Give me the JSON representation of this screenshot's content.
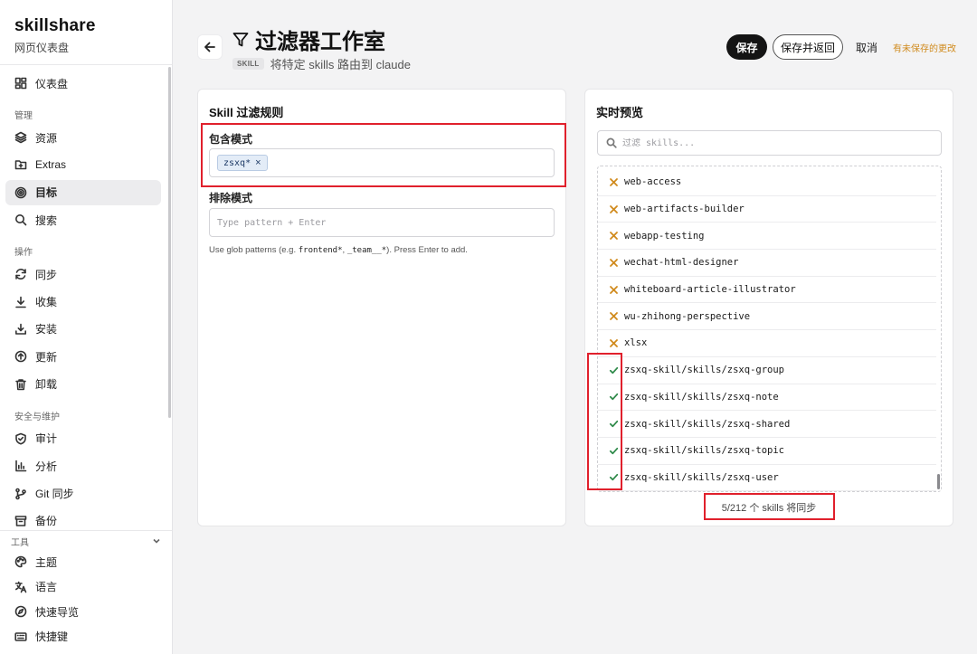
{
  "app": {
    "name": "skillshare",
    "subtitle": "网页仪表盘"
  },
  "sidebar": {
    "top_items": [
      {
        "label": "仪表盘",
        "icon": "dashboard-icon"
      }
    ],
    "sections": [
      {
        "title": "管理",
        "items": [
          {
            "label": "资源",
            "icon": "layers-icon"
          },
          {
            "label": "Extras",
            "icon": "folder-plus-icon"
          },
          {
            "label": "目标",
            "icon": "target-icon",
            "active": true
          },
          {
            "label": "搜索",
            "icon": "search-icon"
          }
        ]
      },
      {
        "title": "操作",
        "items": [
          {
            "label": "同步",
            "icon": "refresh-icon"
          },
          {
            "label": "收集",
            "icon": "download-icon"
          },
          {
            "label": "安装",
            "icon": "install-icon"
          },
          {
            "label": "更新",
            "icon": "upload-circle-icon"
          },
          {
            "label": "卸载",
            "icon": "trash-icon"
          }
        ]
      },
      {
        "title": "安全与维护",
        "items": [
          {
            "label": "审计",
            "icon": "shield-check-icon"
          },
          {
            "label": "分析",
            "icon": "bar-chart-icon"
          },
          {
            "label": "Git 同步",
            "icon": "git-branch-icon"
          },
          {
            "label": "备份",
            "icon": "archive-icon"
          }
        ]
      }
    ],
    "tools": {
      "title": "工具",
      "items": [
        {
          "label": "主题",
          "icon": "palette-icon"
        },
        {
          "label": "语言",
          "icon": "translate-icon"
        },
        {
          "label": "快速导览",
          "icon": "compass-icon"
        },
        {
          "label": "快捷键",
          "icon": "keyboard-icon"
        }
      ]
    }
  },
  "header": {
    "title": "过滤器工作室",
    "badge": "SKILL",
    "subtitle": "将特定 skills 路由到 claude",
    "save_label": "保存",
    "save_return_label": "保存并返回",
    "cancel_label": "取消",
    "unsaved_label": "有未保存的更改"
  },
  "rules": {
    "title": "Skill 过滤规则",
    "include_label": "包含模式",
    "include_tags": [
      "zsxq*"
    ],
    "exclude_label": "排除模式",
    "exclude_placeholder": "Type pattern + Enter",
    "hint_prefix": "Use glob patterns (e.g. ",
    "hint_code1": "frontend*",
    "hint_sep": ", ",
    "hint_code2": "_team__*",
    "hint_suffix": "). Press Enter to add."
  },
  "preview": {
    "title": "实时预览",
    "filter_placeholder": "过滤 skills...",
    "rows": [
      {
        "name": "web-access",
        "included": false
      },
      {
        "name": "web-artifacts-builder",
        "included": false
      },
      {
        "name": "webapp-testing",
        "included": false
      },
      {
        "name": "wechat-html-designer",
        "included": false
      },
      {
        "name": "whiteboard-article-illustrator",
        "included": false
      },
      {
        "name": "wu-zhihong-perspective",
        "included": false
      },
      {
        "name": "xlsx",
        "included": false
      },
      {
        "name": "zsxq-skill/skills/zsxq-group",
        "included": true
      },
      {
        "name": "zsxq-skill/skills/zsxq-note",
        "included": true
      },
      {
        "name": "zsxq-skill/skills/zsxq-shared",
        "included": true
      },
      {
        "name": "zsxq-skill/skills/zsxq-topic",
        "included": true
      },
      {
        "name": "zsxq-skill/skills/zsxq-user",
        "included": true
      }
    ],
    "summary": "5/212 个 skills 将同步"
  },
  "colors": {
    "excluded_mark": "#d08a1c",
    "included_mark": "#2f8a4a",
    "highlight": "#e0202c"
  }
}
